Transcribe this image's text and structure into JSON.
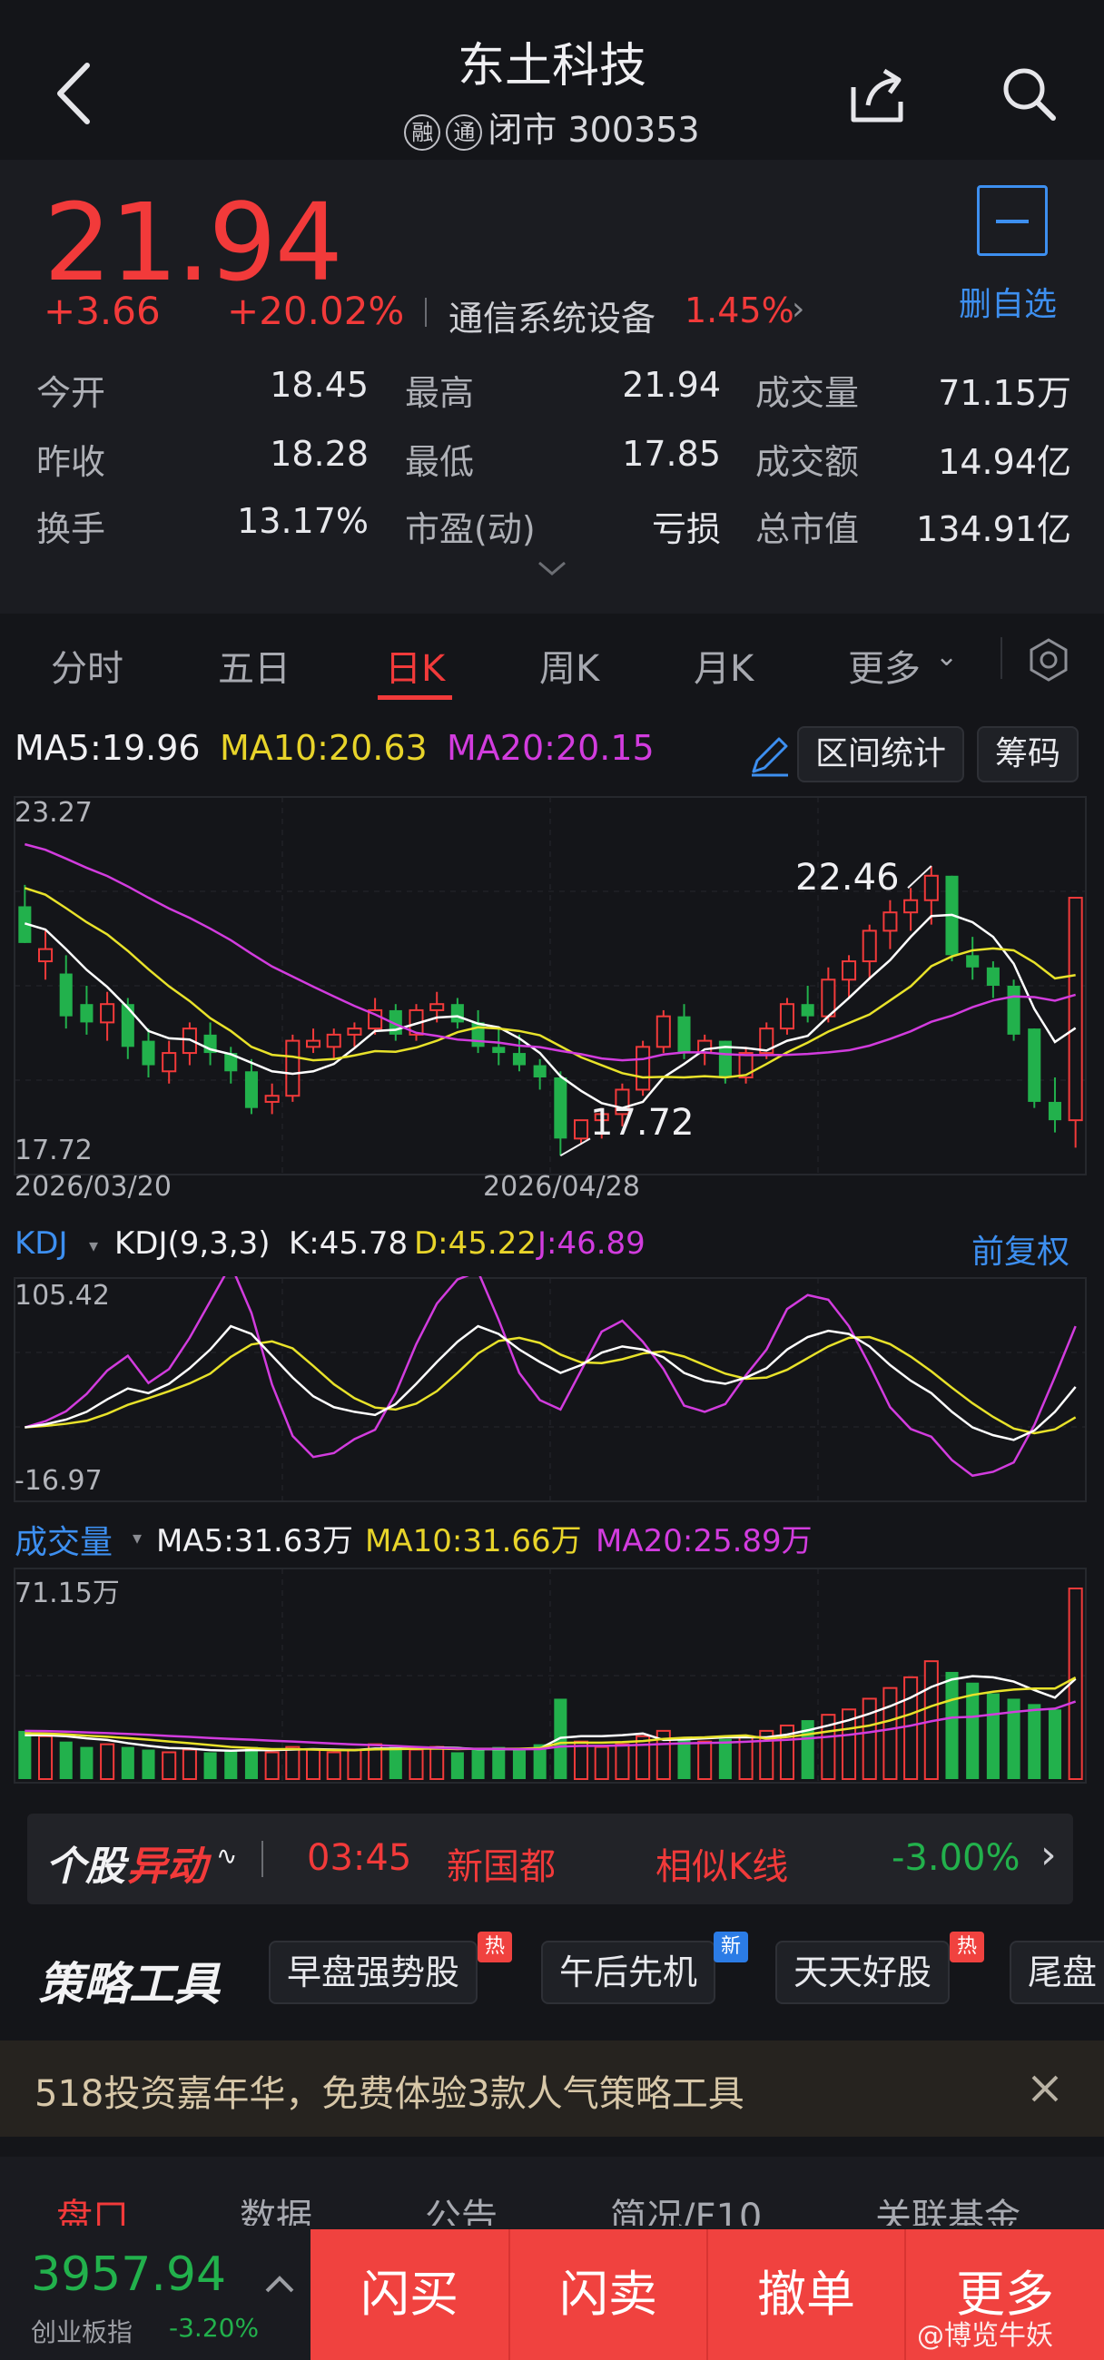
{
  "header": {
    "title": "东土科技",
    "badge1": "融",
    "badge2": "通",
    "status": "闭市 300353"
  },
  "quote": {
    "price": "21.94",
    "change": "+3.66",
    "change_pct": "+20.02%",
    "sector": "通信系统设备",
    "sector_pct": "1.45%",
    "watch_label": "删自选",
    "stats": [
      {
        "label": "今开",
        "value": "18.45",
        "label2": "最高",
        "value2": "21.94",
        "label3": "成交量",
        "value3": "71.15万"
      },
      {
        "label": "昨收",
        "value": "18.28",
        "label2": "最低",
        "value2": "17.85",
        "label3": "成交额",
        "value3": "14.94亿"
      },
      {
        "label": "换手",
        "value": "13.17%",
        "label2": "市盈(动)",
        "value2": "亏损",
        "label3": "总市值",
        "value3": "134.91亿"
      }
    ]
  },
  "tabs": [
    "分时",
    "五日",
    "日K",
    "周K",
    "月K",
    "更多"
  ],
  "chart": {
    "ma5": "MA5:19.96",
    "ma10": "MA10:20.63",
    "ma20": "MA20:20.15",
    "range_btn": "区间统计",
    "chip_btn": "筹码",
    "price_top": "23.27",
    "price_bottom": "17.72",
    "date_left": "2026/03/20",
    "date_mid": "2026/04/28",
    "high_mark": "22.46",
    "low_mark": "17.72",
    "kdj_title": "KDJ",
    "kdj_params": "KDJ(9,3,3)",
    "kdj_k": "K:45.78",
    "kdj_d": "D:45.22",
    "kdj_j": "J:46.89",
    "fq": "前复权",
    "kdj_top": "105.42",
    "kdj_bottom": "-16.97",
    "vol_title": "成交量",
    "vol_ma5": "MA5:31.63万",
    "vol_ma10": "MA10:31.66万",
    "vol_ma20": "MA20:25.89万",
    "vol_top": "71.15万"
  },
  "chart_data": {
    "type": "candlestick",
    "start_date": "2026/03/20",
    "note": "Daily K-line approximated from screenshot",
    "ohlc": [
      [
        21.8,
        22.15,
        21.2,
        21.2
      ],
      [
        20.9,
        21.4,
        20.6,
        21.1
      ],
      [
        20.7,
        21.0,
        19.8,
        20.0
      ],
      [
        20.2,
        20.5,
        19.7,
        19.9
      ],
      [
        19.9,
        20.4,
        19.6,
        20.2
      ],
      [
        20.2,
        20.3,
        19.3,
        19.5
      ],
      [
        19.6,
        19.8,
        19.0,
        19.2
      ],
      [
        19.1,
        19.6,
        18.9,
        19.4
      ],
      [
        19.4,
        19.9,
        19.2,
        19.8
      ],
      [
        19.7,
        19.9,
        19.2,
        19.4
      ],
      [
        19.4,
        19.5,
        18.9,
        19.1
      ],
      [
        19.1,
        19.3,
        18.4,
        18.5
      ],
      [
        18.6,
        18.9,
        18.4,
        18.7
      ],
      [
        18.7,
        19.7,
        18.6,
        19.6
      ],
      [
        19.5,
        19.8,
        19.4,
        19.6
      ],
      [
        19.5,
        19.8,
        19.3,
        19.7
      ],
      [
        19.7,
        19.9,
        19.5,
        19.8
      ],
      [
        19.8,
        20.3,
        19.7,
        20.1
      ],
      [
        20.1,
        20.2,
        19.6,
        19.7
      ],
      [
        19.7,
        20.2,
        19.6,
        20.1
      ],
      [
        20.1,
        20.4,
        19.9,
        20.2
      ],
      [
        20.2,
        20.3,
        19.8,
        19.9
      ],
      [
        19.9,
        20.1,
        19.4,
        19.5
      ],
      [
        19.5,
        19.8,
        19.2,
        19.4
      ],
      [
        19.4,
        19.7,
        19.1,
        19.2
      ],
      [
        19.2,
        19.3,
        18.8,
        19.0
      ],
      [
        19.0,
        19.1,
        17.72,
        18.0
      ],
      [
        18.0,
        18.3,
        17.9,
        18.3
      ],
      [
        18.3,
        18.5,
        18.0,
        18.4
      ],
      [
        18.4,
        18.9,
        18.2,
        18.8
      ],
      [
        18.8,
        19.6,
        18.7,
        19.5
      ],
      [
        19.5,
        20.1,
        19.4,
        20.0
      ],
      [
        20.0,
        20.2,
        19.3,
        19.4
      ],
      [
        19.4,
        19.7,
        19.2,
        19.6
      ],
      [
        19.6,
        19.6,
        18.9,
        19.0
      ],
      [
        19.0,
        19.5,
        18.9,
        19.4
      ],
      [
        19.4,
        19.9,
        19.3,
        19.8
      ],
      [
        19.8,
        20.3,
        19.7,
        20.2
      ],
      [
        20.2,
        20.5,
        19.9,
        20.0
      ],
      [
        20.0,
        20.8,
        19.9,
        20.6
      ],
      [
        20.6,
        21.0,
        20.3,
        20.9
      ],
      [
        20.9,
        21.5,
        20.6,
        21.4
      ],
      [
        21.4,
        21.9,
        21.1,
        21.7
      ],
      [
        21.7,
        22.1,
        21.4,
        21.9
      ],
      [
        21.9,
        22.46,
        21.5,
        22.3
      ],
      [
        22.3,
        22.3,
        20.9,
        21.0
      ],
      [
        21.0,
        21.3,
        20.6,
        20.8
      ],
      [
        20.8,
        20.9,
        20.3,
        20.5
      ],
      [
        20.5,
        20.6,
        19.6,
        19.7
      ],
      [
        19.8,
        19.8,
        18.5,
        18.6
      ],
      [
        18.6,
        19.0,
        18.1,
        18.3
      ],
      [
        18.3,
        21.94,
        17.85,
        21.94
      ]
    ],
    "ylim": [
      17.5,
      23.5
    ]
  },
  "alert": {
    "logo1": "个股",
    "logo2": "异动",
    "time": "03:45",
    "name": "新国都",
    "type": "相似K线",
    "pct": "-3.00%"
  },
  "strategy": {
    "logo": "策略工具",
    "items": [
      {
        "label": "早盘强势股",
        "tag": "热"
      },
      {
        "label": "午后先机",
        "tag": "新"
      },
      {
        "label": "天天好股",
        "tag": "热"
      },
      {
        "label": "尾盘",
        "tag": ""
      }
    ]
  },
  "promo": {
    "text": "518投资嘉年华，免费体验3款人气策略工具"
  },
  "bottom_tabs": [
    "盘口",
    "数据",
    "公告",
    "简况/F10",
    "关联基金"
  ],
  "index": {
    "value": "3957.94",
    "name": "创业板指",
    "pct": "-3.20%"
  },
  "actions": [
    "闪买",
    "闪卖",
    "撤单",
    "更多"
  ],
  "watermark": "@博览牛妖"
}
